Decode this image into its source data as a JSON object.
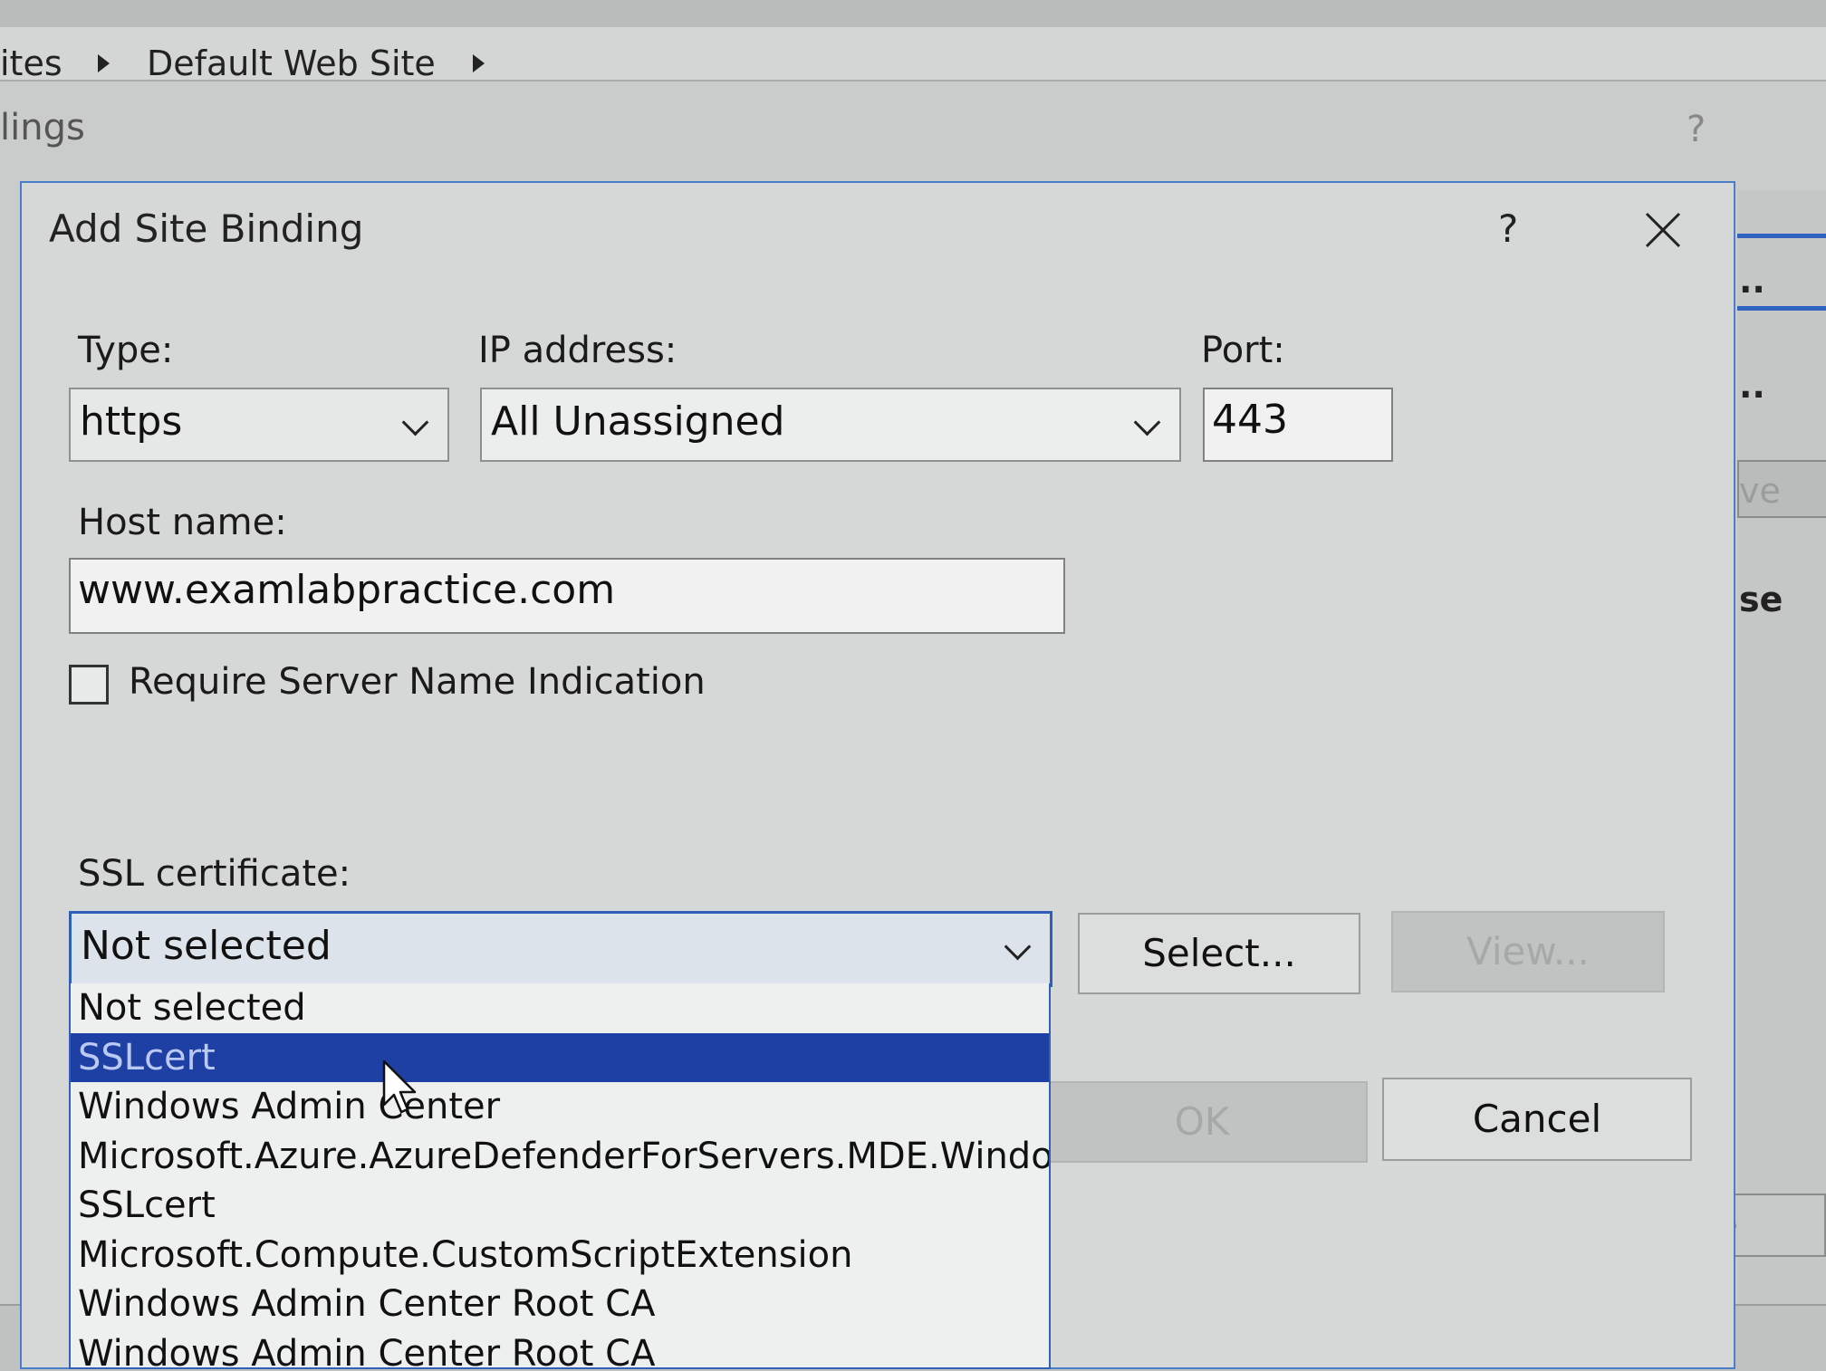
{
  "background": {
    "breadcrumb": [
      "ites",
      "Default Web Site"
    ],
    "panel_title": "lings",
    "help": "?",
    "right_panel": {
      "item_1": "..",
      "item_2": "..",
      "item_3": "ve",
      "item_4": "se"
    },
    "close_label": "Close"
  },
  "dialog": {
    "title": "Add Site Binding",
    "help": "?",
    "type": {
      "label": "Type:",
      "value": "https"
    },
    "ip": {
      "label": "IP address:",
      "value": "All Unassigned"
    },
    "port": {
      "label": "Port:",
      "value": "443"
    },
    "host": {
      "label": "Host name:",
      "value": "www.examlabpractice.com"
    },
    "sni": {
      "label": "Require Server Name Indication",
      "checked": false
    },
    "ssl": {
      "label": "SSL certificate:",
      "value": "Not selected",
      "options": [
        "Not selected",
        "SSLcert",
        "Windows Admin Center",
        "Microsoft.Azure.AzureDefenderForServers.MDE.Window",
        "SSLcert",
        "Microsoft.Compute.CustomScriptExtension",
        "Windows Admin Center Root CA",
        "Windows Admin Center Root CA"
      ],
      "highlighted": "SSLcert"
    },
    "buttons": {
      "select": "Select...",
      "view": "View...",
      "ok": "OK",
      "cancel": "Cancel"
    }
  },
  "colors": {
    "selection": "#1e3fa4",
    "focus_border": "#2f5fb8"
  }
}
